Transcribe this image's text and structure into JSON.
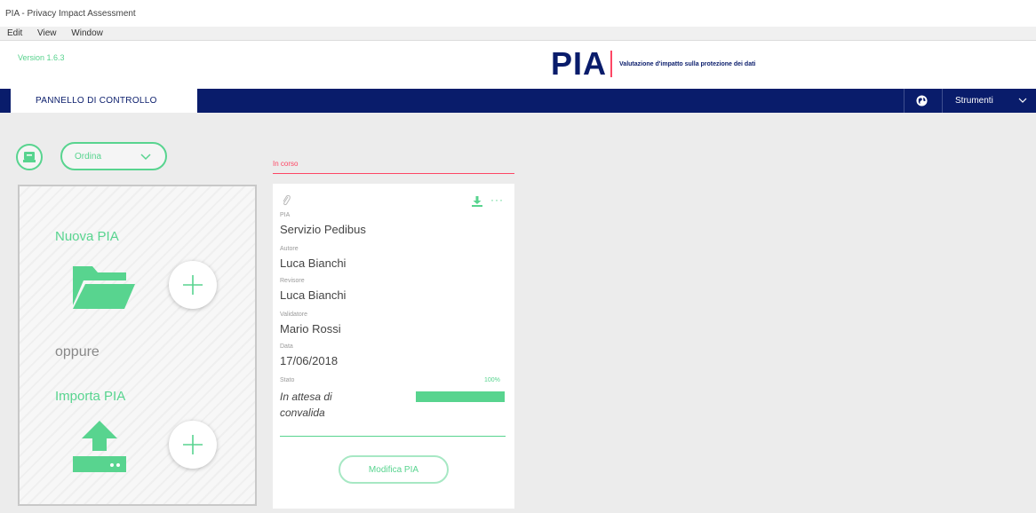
{
  "window": {
    "title": "PIA - Privacy Impact Assessment"
  },
  "menu": [
    "Edit",
    "View",
    "Window"
  ],
  "header": {
    "version": "Version 1.6.3",
    "logo_text": "PIA",
    "tagline": "Valutazione d'impatto sulla protezione dei dati"
  },
  "nav": {
    "dashboard_tab": "PANNELLO DI CONTROLLO",
    "tools": "Strumenti"
  },
  "toolbar": {
    "sort_label": "Ordina"
  },
  "left_panel": {
    "new_pia": "Nuova PIA",
    "or": "oppure",
    "import_pia": "Importa PIA"
  },
  "status_column": {
    "title": "In corso"
  },
  "card": {
    "more_glyph": "···",
    "fields": [
      {
        "label": "PIA",
        "value": "Servizio Pedibus"
      },
      {
        "label": "Autore",
        "value": "Luca Bianchi"
      },
      {
        "label": "Revisore",
        "value": "Luca Bianchi"
      },
      {
        "label": "Validatore",
        "value": "Mario Rossi"
      },
      {
        "label": "Data",
        "value": "17/06/2018"
      }
    ],
    "status_label": "Stato",
    "status_value": "In attesa di convalida",
    "progress_percent_text": "100%",
    "progress": 1.0,
    "edit_button": "Modifica PIA"
  },
  "colors": {
    "navy": "#091c6b",
    "green": "#58d48f",
    "red": "#fd4664"
  }
}
